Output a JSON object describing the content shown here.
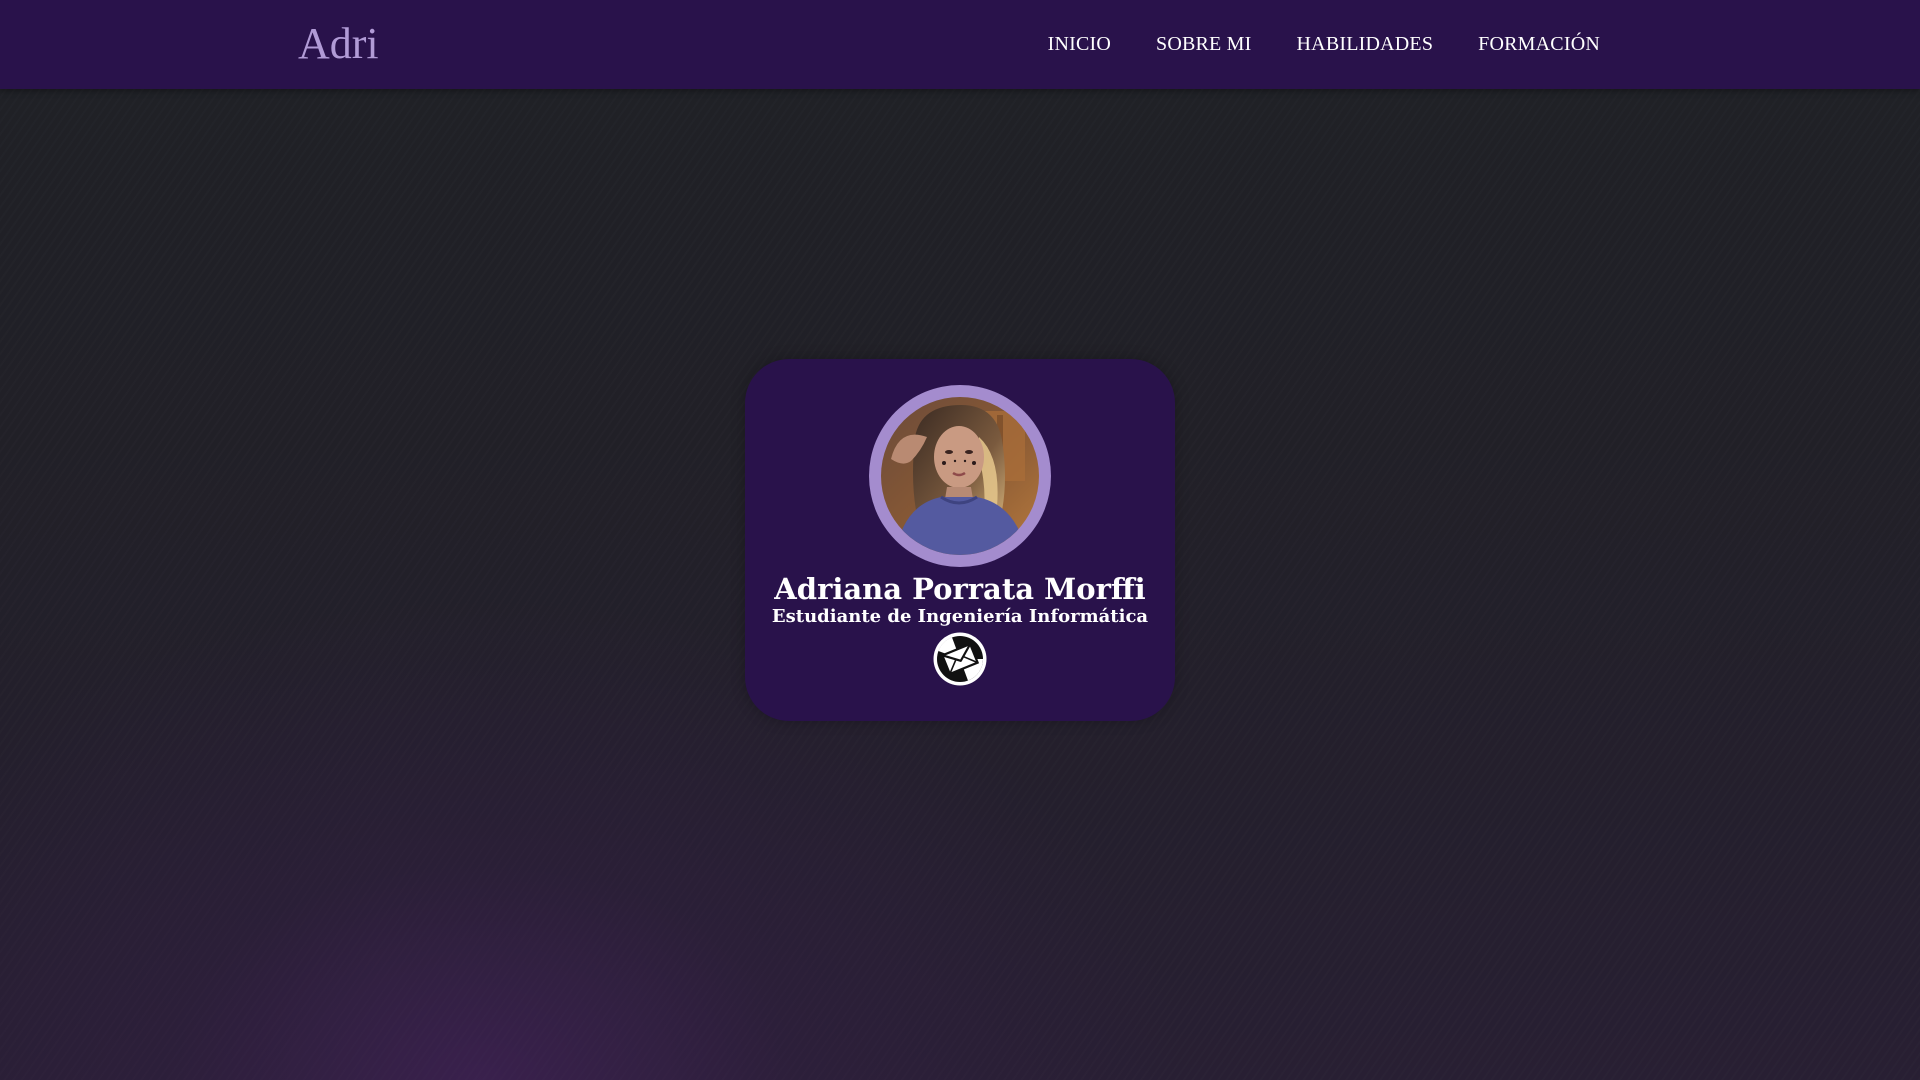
{
  "header": {
    "brand": "Adri",
    "nav": [
      {
        "label": "INICIO"
      },
      {
        "label": "SOBRE MI"
      },
      {
        "label": "HABILIDADES"
      },
      {
        "label": "FORMACIÓN"
      }
    ]
  },
  "profile": {
    "name": "Adriana Porrata Morffi",
    "subtitle": "Estudiante de Ingeniería Informática",
    "photo_icon": "profile-photo",
    "contact_icon": "mail-icon"
  },
  "colors": {
    "navbar_bg": "#29124b",
    "brand": "#b19bd6",
    "card_bg": "#29124b",
    "avatar_ring": "#a48cce",
    "page_bg": "#202126",
    "text": "#ffffff"
  }
}
